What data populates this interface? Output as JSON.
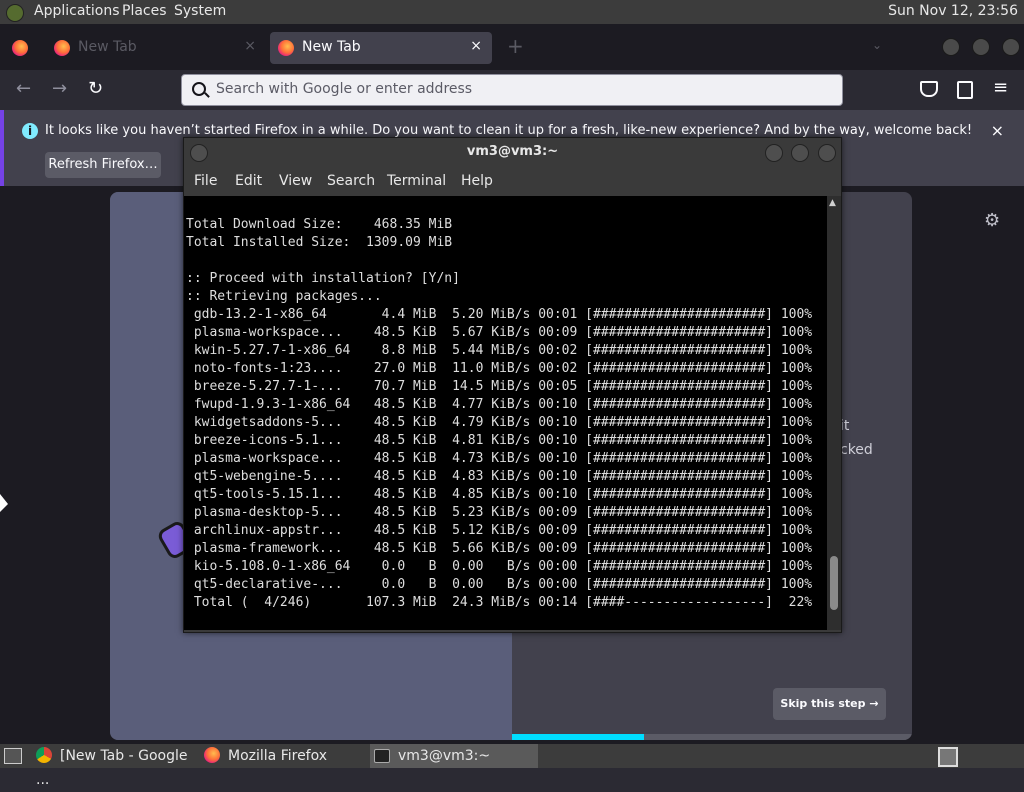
{
  "panel": {
    "applications": "Applications",
    "places": "Places",
    "system": "System",
    "clock": "Sun Nov 12, 23:56"
  },
  "browser": {
    "tabs": [
      {
        "label": "New Tab",
        "state": "background"
      },
      {
        "label": "New Tab",
        "state": "active"
      }
    ],
    "new_tab_icon": "+",
    "close_icon": "×",
    "url_placeholder": "Search with Google or enter address",
    "nav": {
      "back": "←",
      "forward": "→",
      "reload": "↻"
    },
    "toolbar_icons": [
      "pocket-icon",
      "extensions-icon",
      "menu-icon"
    ],
    "notification": {
      "message": "It looks like you haven’t started Firefox in a while. Do you want to clean it up for a fresh, like-new experience? And by the way, welcome back!",
      "button": "Refresh Firefox…",
      "info_icon": "i"
    }
  },
  "page": {
    "right_text_1": "it",
    "right_text_2": "cked",
    "skip_button": "Skip this step →",
    "progress_fraction": 0.33,
    "accent": "#00ddff"
  },
  "terminal": {
    "title": "vm3@vm3:~",
    "menu": [
      "File",
      "Edit",
      "View",
      "Search",
      "Terminal",
      "Help"
    ],
    "lines": [
      "Total Download Size:    468.35 MiB",
      "Total Installed Size:  1309.09 MiB",
      "",
      ":: Proceed with installation? [Y/n]",
      ":: Retrieving packages...",
      " gdb-13.2-1-x86_64       4.4 MiB  5.20 MiB/s 00:01 [######################] 100%",
      " plasma-workspace...    48.5 KiB  5.67 KiB/s 00:09 [######################] 100%",
      " kwin-5.27.7-1-x86_64    8.8 MiB  5.44 MiB/s 00:02 [######################] 100%",
      " noto-fonts-1:23....    27.0 MiB  11.0 MiB/s 00:02 [######################] 100%",
      " breeze-5.27.7-1-...    70.7 MiB  14.5 MiB/s 00:05 [######################] 100%",
      " fwupd-1.9.3-1-x86_64   48.5 KiB  4.77 KiB/s 00:10 [######################] 100%",
      " kwidgetsaddons-5...    48.5 KiB  4.79 KiB/s 00:10 [######################] 100%",
      " breeze-icons-5.1...    48.5 KiB  4.81 KiB/s 00:10 [######################] 100%",
      " plasma-workspace...    48.5 KiB  4.73 KiB/s 00:10 [######################] 100%",
      " qt5-webengine-5....    48.5 KiB  4.83 KiB/s 00:10 [######################] 100%",
      " qt5-tools-5.15.1...    48.5 KiB  4.85 KiB/s 00:10 [######################] 100%",
      " plasma-desktop-5...    48.5 KiB  5.23 KiB/s 00:09 [######################] 100%",
      " archlinux-appstr...    48.5 KiB  5.12 KiB/s 00:09 [######################] 100%",
      " plasma-framework...    48.5 KiB  5.66 KiB/s 00:09 [######################] 100%",
      " kio-5.108.0-1-x86_64    0.0   B  0.00   B/s 00:00 [######################] 100%",
      " qt5-declarative-...     0.0   B  0.00   B/s 00:00 [######################] 100%",
      " Total (  4/246)       107.3 MiB  24.3 MiB/s 00:14 [####------------------]  22%"
    ]
  },
  "taskbar": {
    "items": [
      {
        "label": "[New Tab - Google ..."
      },
      {
        "label": "Mozilla Firefox"
      },
      {
        "label": "vm3@vm3:~"
      }
    ]
  }
}
